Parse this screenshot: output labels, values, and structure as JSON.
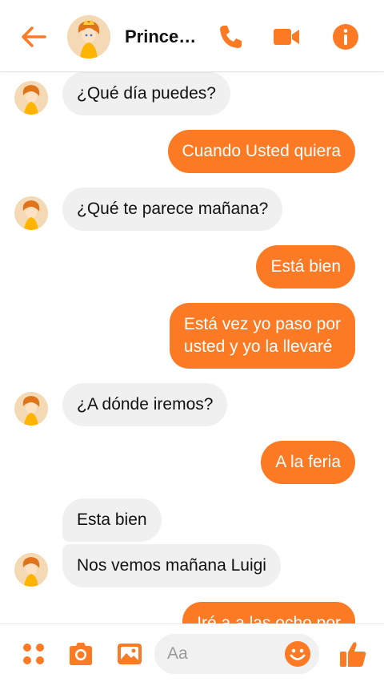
{
  "header": {
    "contact_name": "Prince…",
    "accent_color": "#fd7a24",
    "icons": [
      "back-arrow-icon",
      "phone-icon",
      "video-camera-icon",
      "info-icon"
    ]
  },
  "messages": [
    {
      "side": "in",
      "text": "¿Qué día puedes?",
      "avatar": true
    },
    {
      "side": "out",
      "text": "Cuando Usted quiera"
    },
    {
      "side": "in",
      "text": "¿Qué te parece mañana?",
      "avatar": true
    },
    {
      "side": "out",
      "text": "Está bien"
    },
    {
      "side": "out",
      "text_lines": [
        "Está vez yo paso por",
        "usted y yo la llevaré"
      ]
    },
    {
      "side": "in",
      "text": "¿A dónde iremos?",
      "avatar": true
    },
    {
      "side": "out",
      "text": "A la feria"
    },
    {
      "side": "in",
      "text": "Esta bien",
      "avatar": false
    },
    {
      "side": "in",
      "text": "Nos vemos mañana Luigi",
      "avatar": true
    },
    {
      "side": "out",
      "text": "Iré a a las ocho por",
      "partially_visible": true
    }
  ],
  "composer": {
    "placeholder": "Aa",
    "icons": [
      "apps-grid-icon",
      "camera-icon",
      "image-icon",
      "emoji-icon",
      "thumbs-up-icon"
    ]
  },
  "colors": {
    "outgoing_bubble": "#fd7a24",
    "incoming_bubble": "#f0f0f0"
  }
}
